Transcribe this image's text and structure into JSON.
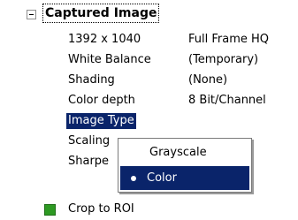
{
  "header": {
    "title": "Captured Image"
  },
  "properties": [
    {
      "name": "1392 x 1040",
      "value": "Full Frame HQ"
    },
    {
      "name": "White Balance",
      "value": "(Temporary)"
    },
    {
      "name": "Shading",
      "value": "(None)"
    },
    {
      "name": "Color depth",
      "value": "8 Bit/Channel"
    },
    {
      "name": "Image Type",
      "value": ""
    },
    {
      "name": "Scaling",
      "value": ""
    },
    {
      "name": "Sharpe",
      "value": ""
    }
  ],
  "crop": {
    "label": "Crop to ROI",
    "color": "#2e9a23"
  },
  "popup": {
    "items": [
      {
        "label": "Grayscale",
        "selected": false
      },
      {
        "label": "Color",
        "selected": true
      }
    ],
    "selected_color": "#0a246a"
  }
}
